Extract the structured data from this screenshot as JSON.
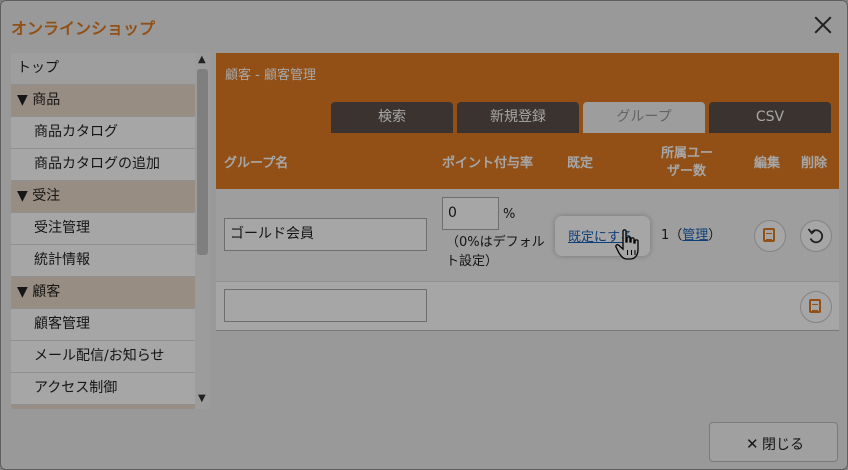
{
  "window": {
    "title": "オンラインショップ"
  },
  "sidebar": {
    "items": [
      {
        "label": "トップ",
        "kind": "top"
      },
      {
        "label": "▼ 商品",
        "kind": "cat"
      },
      {
        "label": "商品カタログ",
        "kind": "sub"
      },
      {
        "label": "商品カタログの追加",
        "kind": "sub"
      },
      {
        "label": "▼ 受注",
        "kind": "cat"
      },
      {
        "label": "受注管理",
        "kind": "sub"
      },
      {
        "label": "統計情報",
        "kind": "sub"
      },
      {
        "label": "▼ 顧客",
        "kind": "cat"
      },
      {
        "label": "顧客管理",
        "kind": "sub"
      },
      {
        "label": "メール配信/お知らせ",
        "kind": "sub"
      },
      {
        "label": "アクセス制御",
        "kind": "sub"
      },
      {
        "label": "",
        "kind": "cat"
      }
    ]
  },
  "main": {
    "breadcrumb": "顧客 - 顧客管理",
    "tabs": [
      {
        "label": "検索",
        "active": false
      },
      {
        "label": "新規登録",
        "active": false
      },
      {
        "label": "グループ",
        "active": true
      },
      {
        "label": "CSV",
        "active": false
      }
    ],
    "columns": {
      "group_name": "グループ名",
      "point_rate": "ポイント付与率",
      "default": "既定",
      "members_1": "所属ユー",
      "members_2": "ザー数",
      "edit": "編集",
      "delete": "削除"
    },
    "rows": [
      {
        "name": "ゴールド会員",
        "point": "0",
        "percent": "%",
        "note_1": "（0%はデフォル",
        "note_2": "ト設定）",
        "default_action": "既定にする",
        "members_count": "1（",
        "manage_link": "管理",
        "members_close": "）"
      }
    ]
  },
  "footer": {
    "close_label": "閉じる"
  },
  "colors": {
    "accent": "#e07b23",
    "tab_dark": "#5a4f49"
  },
  "icons": [
    "close-icon",
    "edit-icon",
    "undo-icon",
    "hand-cursor-icon"
  ]
}
